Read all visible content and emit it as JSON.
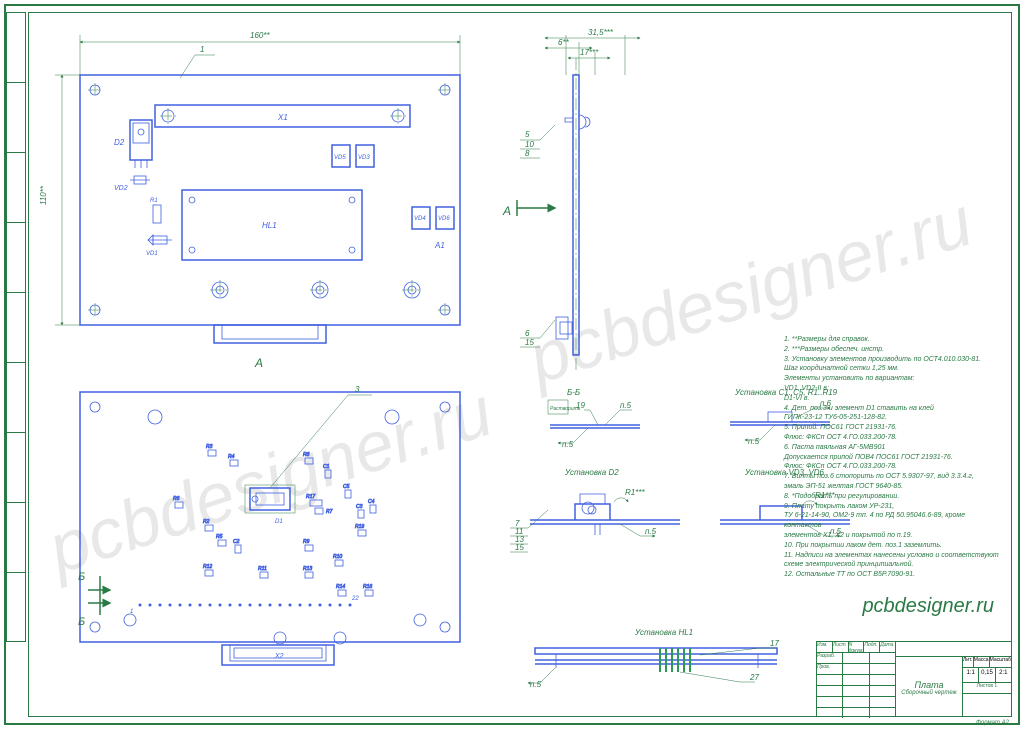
{
  "dimensions": {
    "top_width": "160**",
    "left_height": "110**",
    "side_total": "31,5***",
    "side_dim1": "6**",
    "side_dim2": "17***",
    "side_callout_5": "5",
    "side_callout_10": "10",
    "side_callout_8": "8",
    "side_callout_6": "6",
    "side_callout_15": "15"
  },
  "labels": {
    "top_board_marker": "1",
    "X1": "X1",
    "D2": "D2",
    "VD2": "VD2",
    "VD5": "VD5",
    "VD3": "VD3",
    "R1": "R1",
    "VD1": "VD1",
    "HL1": "HL1",
    "VD4": "VD4",
    "VD6": "VD6",
    "A1": "А1",
    "section_A": "А",
    "side_section_A": "А",
    "J_marker": "3",
    "D1": "D1",
    "R3": "R3",
    "R4": "R4",
    "R8": "R8",
    "R6": "R6",
    "C1": "C1",
    "C5": "C5",
    "R2": "R2",
    "R5": "R5",
    "C2": "C2",
    "R17": "R17",
    "R7": "R7",
    "C3": "C3",
    "C4": "C4",
    "R19": "R19",
    "R12": "R12",
    "R11": "R11",
    "R9": "R9",
    "R13": "R13",
    "R10": "R10",
    "R14": "R14",
    "R16": "R16",
    "B_top": "Б",
    "B_bottom": "Б",
    "X2": "X2",
    "bottom_1": "1",
    "bottom_22": "22",
    "install1": "Установка C1..C5, R1..R19",
    "install2": "Установка D2",
    "install3": "Установка VD3..VD6",
    "install4": "Установка HL1",
    "bb_section": "Б-Б",
    "pos_19": "19",
    "rastvoriat": "Растворить",
    "p5": "п.5",
    "p6": "п.6",
    "R1_dim": "R1***",
    "callout_7": "7",
    "callout_11": "11",
    "callout_13": "13",
    "callout_15b": "15",
    "callout_17": "17",
    "callout_27": "27"
  },
  "notes": [
    "1. **Размеры для справок.",
    "2. ***Размеры обеспеч. инстр.",
    "3. Установку элементов производить по ОСТ4.010.030-81.",
    "   Шаг координатной сетки 1,25 мм.",
    "   Элементы установить по вариантам:",
    "   VD1, VD2-II в;",
    "   D1-VI в.",
    "4. Дет. поз.3 и элемент D1 ставить на клей",
    "   ГИПК-23-12  ТУ6-05-251-128-82.",
    "5. Припой: ПОС61 ГОСТ 21931-76.",
    "   Флюс: ФКСп ОСТ 4.ГО.033.200-78.",
    "6. Паста паяльная АГ-5МВ901",
    "   Допускается припой ПОВ4 ПОС61 ГОСТ 21931-76.",
    "   Флюс: ФКСп ОСТ 4.ГО.033.200-78.",
    "7. Винты поз.6 стопорить по ОСТ 5.9307-97, вид 3.3.4.г,",
    "   эмаль ЭП-51 желтая ГОСТ 9640-85.",
    "8. *Подобрать при регулировании.",
    "9. Плату покрыть лаком УР-231,",
    "   ТУ 6-21-14-90, ОМ2-9 тп. 4 по РД 50.95046.6-89, кроме контактов",
    "   элементов X1, X2 и покрытой по п.19.",
    "10. При покрытии лаком дет. поз.1 заземлить.",
    "11. Надписи на элементах нанесены условно и соответствуют",
    "    схеме электрической принципиальной.",
    "12. Остальные ТТ по ОСТ В5Р.7090-91."
  ],
  "title_block": {
    "main": "Плата",
    "sub": "Сборочный чертеж",
    "scale1": "1:1",
    "mass": "0,15",
    "scale2": "2:1",
    "masshtab": "Масштаб",
    "lit": "Лит.",
    "massa": "Масса",
    "izm": "Изм.",
    "list": "Лист",
    "ndok": "N докум.",
    "podp": "Подп.",
    "data": "Дата",
    "razrab": "Разраб.",
    "prov": "Пров.",
    "listov": "Листов  1",
    "format": "Формат А2"
  },
  "site": "pcbdesigner.ru"
}
